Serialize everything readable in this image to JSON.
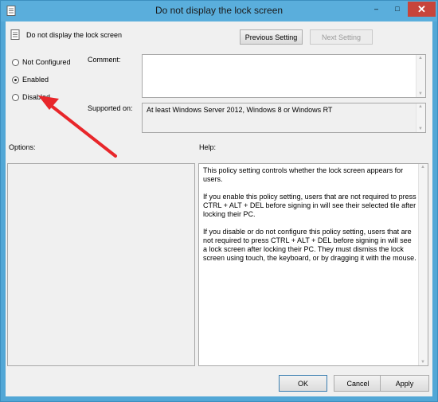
{
  "window": {
    "title": "Do not display the lock screen",
    "title_icon": "policy-icon",
    "controls": {
      "minimize": "–",
      "maximize": "□",
      "close": "✕"
    }
  },
  "header": {
    "policy_name": "Do not display the lock screen",
    "policy_icon": "policy-icon",
    "previous_label": "Previous Setting",
    "next_label": "Next Setting"
  },
  "state": {
    "options": [
      {
        "label": "Not Configured",
        "selected": false
      },
      {
        "label": "Enabled",
        "selected": true
      },
      {
        "label": "Disabled",
        "selected": false
      }
    ]
  },
  "comment": {
    "label": "Comment:",
    "value": ""
  },
  "supported": {
    "label": "Supported on:",
    "value": "At least Windows Server 2012, Windows 8 or Windows RT"
  },
  "options_pane": {
    "label": "Options:"
  },
  "help_pane": {
    "label": "Help:",
    "text": "This policy setting controls whether the lock screen appears for users.\n\nIf you enable this policy setting, users that are not required to press CTRL + ALT + DEL before signing in will see their selected tile after  locking their PC.\n\nIf you disable or do not configure this policy setting, users that are not required to press CTRL + ALT + DEL before signing in will see a lock screen after locking their PC. They must dismiss the lock screen using touch, the keyboard, or by dragging it with the mouse."
  },
  "footer": {
    "ok_label": "OK",
    "cancel_label": "Cancel",
    "apply_label": "Apply"
  },
  "annotation": {
    "arrow_color": "#e8262a"
  }
}
